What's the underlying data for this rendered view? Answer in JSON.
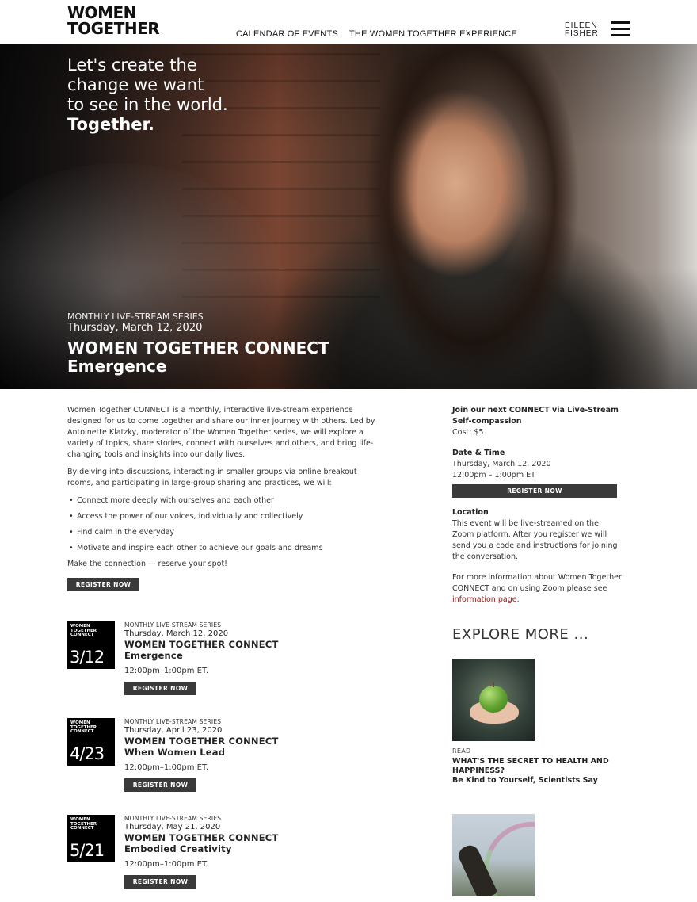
{
  "header": {
    "logo_line1": "WOMEN",
    "logo_line2": "TOGETHER",
    "nav": [
      "CALENDAR OF EVENTS",
      "THE WOMEN TOGETHER EXPERIENCE"
    ],
    "partner_line1": "EILEEN",
    "partner_line2": "FISHER"
  },
  "hero": {
    "headline_lines": [
      "Let's create the",
      "change we want",
      "to see in the world."
    ],
    "headline_bold": "Together.",
    "series": "MONTHLY LIVE-STREAM SERIES",
    "date": "Thursday, March 12, 2020",
    "title": "WOMEN TOGETHER CONNECT",
    "subtitle": "Emergence"
  },
  "intro": {
    "p1": "Women Together CONNECT is a monthly, interactive live-stream experience designed for us to come together and share our inner journey with others. Led by Antoinette Klatzky, moderator of the Women Together series, we will explore a variety of topics, share stories, connect with ourselves and others, and bring life-changing tools and insights into our daily lives.",
    "p2": "By delving into discussions, interacting in smaller groups via online breakout rooms, and participating in large-group sharing and practices, we will:",
    "bullets": [
      "Connect more deeply with ourselves and each other",
      "Access the power of our voices, individually and collectively",
      "Find calm in the everyday",
      "Motivate and inspire each other to achieve our goals and dreams"
    ],
    "closing": "Make the connection — reserve your spot!",
    "register_label": "REGISTER NOW"
  },
  "events": [
    {
      "badge_logo": [
        "WOMEN",
        "TOGETHER",
        "CONNECT"
      ],
      "badge_date": "3/12",
      "series": "MONTHLY LIVE-STREAM SERIES",
      "date": "Thursday, March 12, 2020",
      "title": "WOMEN TOGETHER CONNECT",
      "subtitle": "Emergence",
      "time": "12:00pm–1:00pm ET.",
      "register_label": "REGISTER NOW"
    },
    {
      "badge_logo": [
        "WOMEN",
        "TOGETHER",
        "CONNECT"
      ],
      "badge_date": "4/23",
      "series": "MONTHLY LIVE-STREAM SERIES",
      "date": "Thursday, April 23, 2020",
      "title": "WOMEN TOGETHER CONNECT",
      "subtitle": "When Women Lead",
      "time": "12:00pm–1:00pm ET.",
      "register_label": "REGISTER NOW"
    },
    {
      "badge_logo": [
        "WOMEN",
        "TOGETHER",
        "CONNECT"
      ],
      "badge_date": "5/21",
      "series": "MONTHLY LIVE-STREAM SERIES",
      "date": "Thursday, May 21, 2020",
      "title": "WOMEN TOGETHER CONNECT",
      "subtitle": "Embodied Creativity",
      "time": "12:00pm–1:00pm ET.",
      "register_label": "REGISTER NOW"
    }
  ],
  "sidebar": {
    "join_heading": "Join our next CONNECT via Live-Stream",
    "join_topic": "Self-compassion",
    "cost": "Cost: $5",
    "datetime_heading": "Date & Time",
    "datetime_date": "Thursday, March 12, 2020",
    "datetime_time": "12:00pm – 1:00pm ET",
    "register_label": "REGISTER NOW",
    "location_heading": "Location",
    "location_text": "This event will be live-streamed on the Zoom platform. After you register we will send you a code and instructions for joining the conversation.",
    "info_text": "For more information about Women Together CONNECT and on using Zoom please see",
    "info_link": "information page",
    "info_end": "."
  },
  "explore": {
    "heading": "EXPLORE MORE ...",
    "items": [
      {
        "tag": "READ",
        "title": "WHAT'S THE SECRET TO HEALTH AND HAPPINESS?",
        "subtitle": "Be Kind to Yourself, Scientists Say"
      }
    ]
  },
  "colors": {
    "button_bg": "#3a3a3a",
    "link": "#8b1a1a",
    "text": "#222222"
  }
}
